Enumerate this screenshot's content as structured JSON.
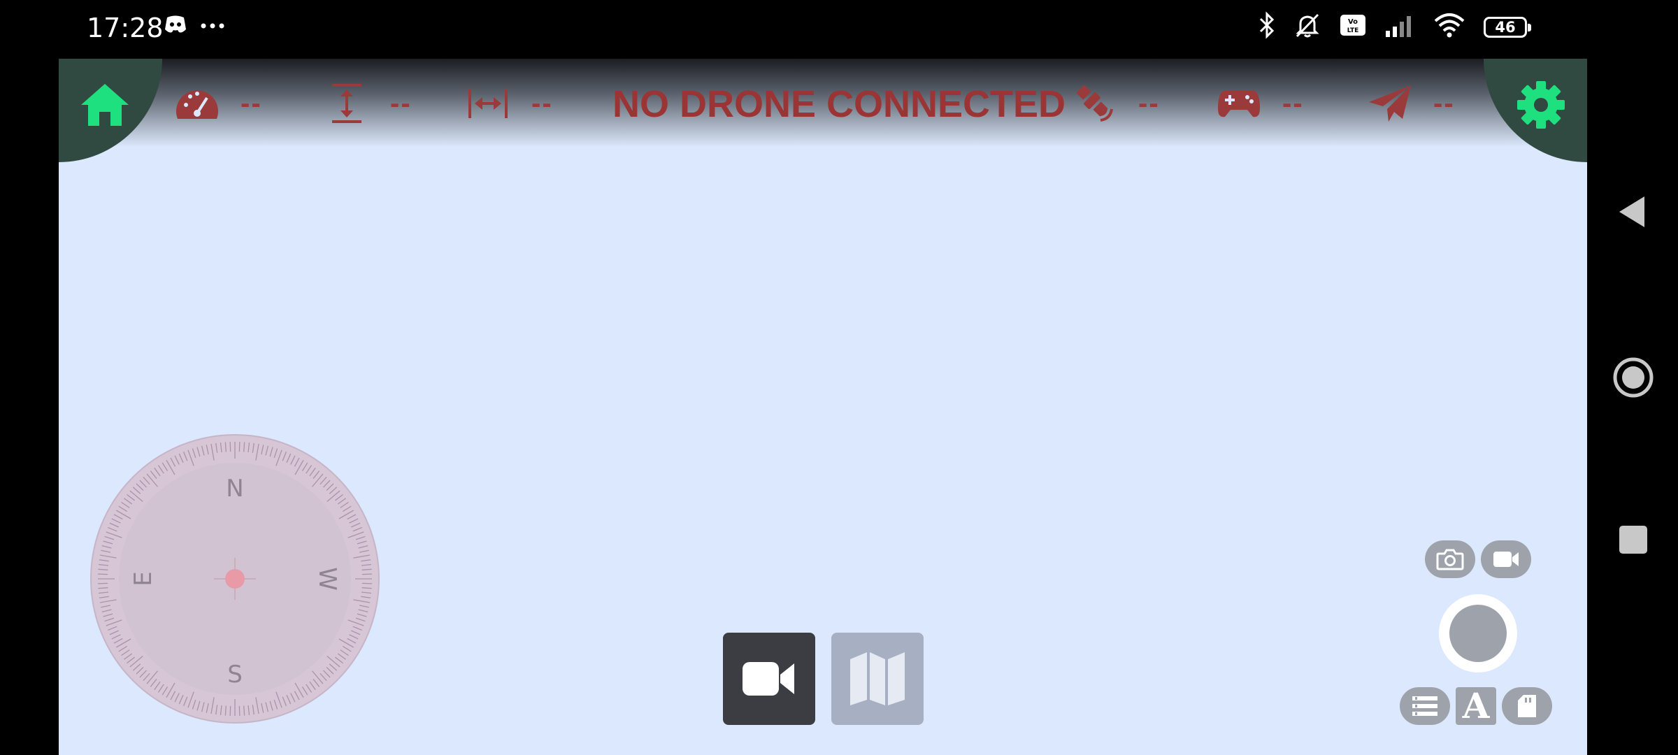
{
  "status_bar": {
    "time": "17:28",
    "battery_level": "46",
    "icons": [
      "discord-icon",
      "more-dots-icon",
      "bluetooth-icon",
      "mute-icon",
      "volte-icon",
      "signal-icon",
      "wifi-icon",
      "battery-icon"
    ]
  },
  "top_bar": {
    "home_icon": "home-icon",
    "settings_icon": "gear-icon",
    "connection_status": "NO DRONE CONNECTED",
    "telemetry": [
      {
        "icon": "speedometer-icon",
        "value": "--"
      },
      {
        "icon": "altitude-icon",
        "value": "--"
      },
      {
        "icon": "distance-icon",
        "value": "--"
      },
      {
        "icon": "satellite-icon",
        "value": "--"
      },
      {
        "icon": "gamepad-icon",
        "value": "--"
      },
      {
        "icon": "paper-plane-icon",
        "value": "--"
      }
    ]
  },
  "compass": {
    "labels": {
      "north": "N",
      "south": "S",
      "east": "E",
      "west": "W"
    }
  },
  "view_toggle": {
    "video": "video-camera-icon",
    "map": "map-icon",
    "active": "video"
  },
  "camera_controls": {
    "photo_mode": "camera-icon",
    "video_mode": "video-camera-icon",
    "shutter": "shutter-button",
    "bottom": [
      "list-icon",
      "font-icon",
      "sd-card-icon"
    ],
    "font_label": "A"
  },
  "colors": {
    "background": "#dbe8fd",
    "accent_green": "#1ee07f",
    "warning_red": "#9b3434",
    "corner_dark": "#314a41"
  }
}
